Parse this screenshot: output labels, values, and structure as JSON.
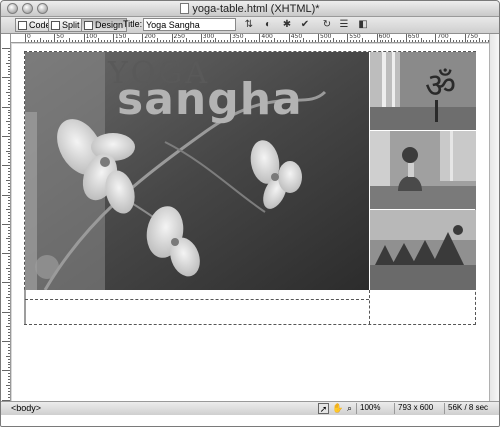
{
  "window": {
    "title": "yoga-table.html (XHTML)*"
  },
  "toolbar": {
    "code_label": "Code",
    "split_label": "Split",
    "design_label": "Design",
    "title_label": "Title:",
    "title_value": "Yoga Sangha",
    "icons": [
      "file-management-icon",
      "preview-icon",
      "debug-icon",
      "validate-icon",
      "refresh-icon",
      "view-options-icon",
      "visual-aids-icon"
    ]
  },
  "ruler": {
    "top_numbers": [
      "0",
      "50",
      "100",
      "150",
      "200",
      "250",
      "300",
      "350",
      "400",
      "450",
      "500",
      "550",
      "600",
      "650",
      "700",
      "750"
    ]
  },
  "design": {
    "brand_small": "YOGA",
    "brand_large": "sangha"
  },
  "statusbar": {
    "tag_selector": "<body>",
    "zoom": "100%",
    "window_size": "793 x 600",
    "download": "56K / 8 sec"
  },
  "colors": {
    "chrome": "#d8d8d8",
    "brand_text": "#b3b3b3",
    "hero_bg": "#3a3a3a"
  }
}
